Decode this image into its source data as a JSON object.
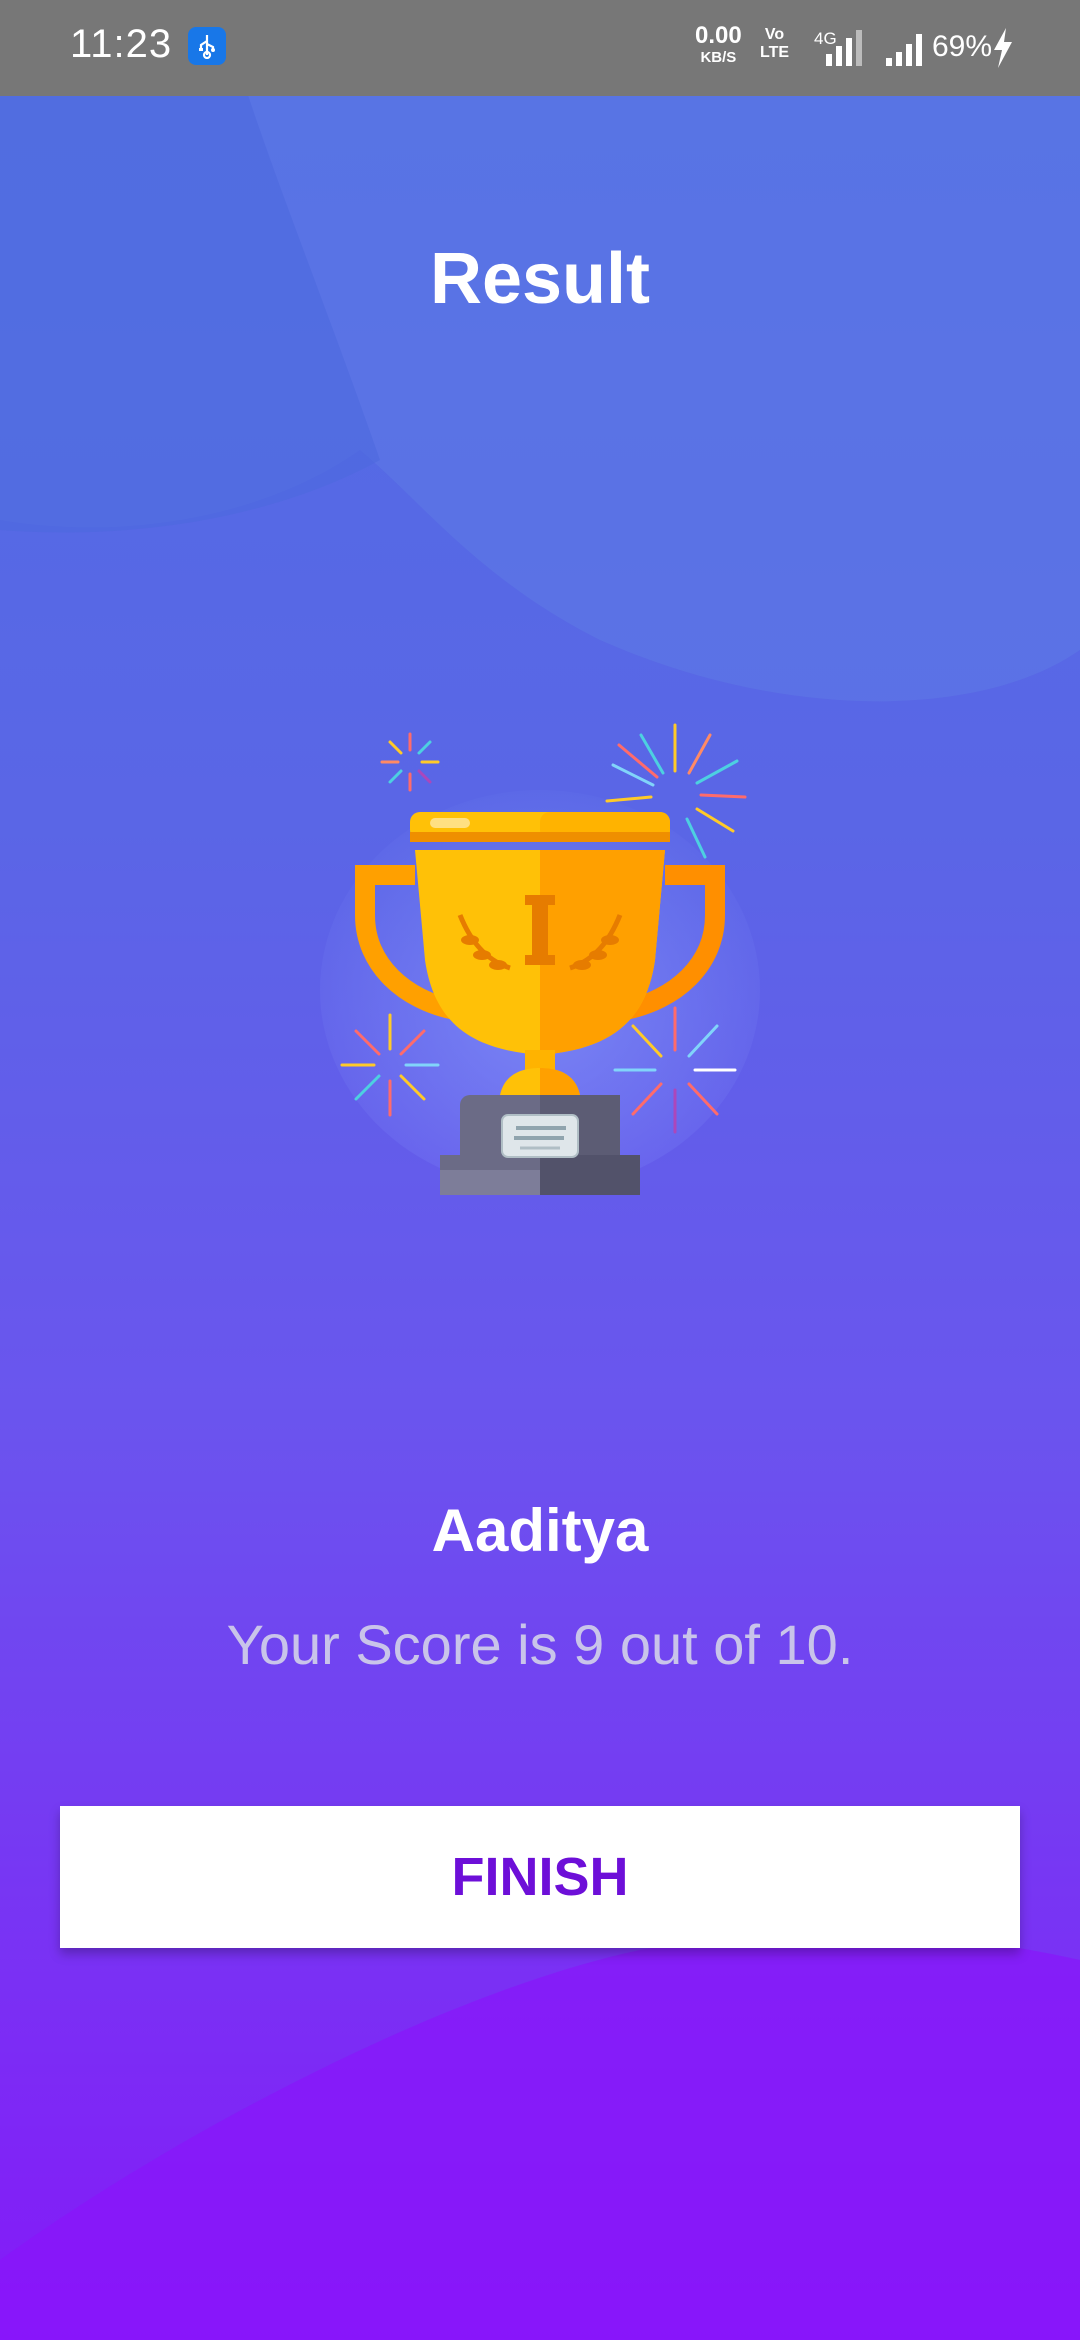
{
  "status_bar": {
    "time": "11:23",
    "net_speed_value": "0.00",
    "net_speed_unit": "KB/S",
    "volte_line1": "Vo",
    "volte_line2": "LTE",
    "network_type": "4G",
    "battery_percent": "69%"
  },
  "page": {
    "title": "Result"
  },
  "result": {
    "player_name": "Aaditya",
    "score_text": "Your Score is 9 out of 10."
  },
  "actions": {
    "finish_label": "FINISH"
  },
  "colors": {
    "button_text": "#6d0fd8",
    "gradient_top": "#4f6ee3",
    "gradient_bottom": "#8419f8",
    "trophy_gold": "#ffc107",
    "trophy_orange": "#ffa000"
  }
}
